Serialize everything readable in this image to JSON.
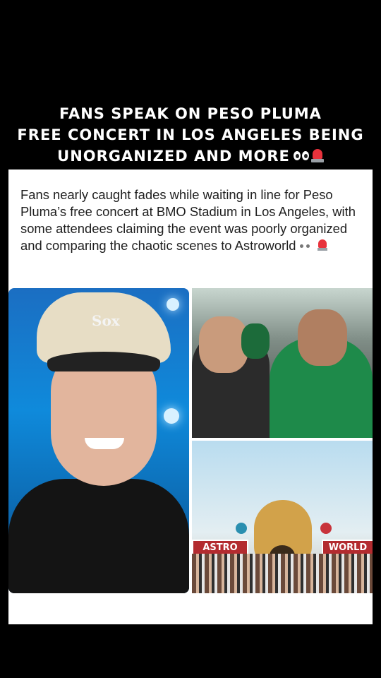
{
  "headline": {
    "line1": "FANS SPEAK ON PESO PLUMA",
    "line2": "FREE CONCERT IN LOS ANGELES BEING",
    "line3": "UNORGANIZED AND MORE",
    "emojis": [
      "eyes-icon",
      "siren-icon"
    ]
  },
  "article": {
    "body": "Fans nearly caught fades while waiting in line for Peso Pluma’s free concert at BMO Stadium in Los Angeles, with some attendees claiming the event was poorly organized and comparing the chaotic scenes to Astroworld"
  },
  "images": {
    "left_logo": "Sox",
    "bottom_right_sign_left": "ASTRO",
    "bottom_right_sign_right": "WORLD"
  },
  "colors": {
    "background": "#000000",
    "card": "#ffffff",
    "headline_text": "#ffffff",
    "body_text": "#1e1e1e",
    "siren_red": "#e8323c"
  }
}
